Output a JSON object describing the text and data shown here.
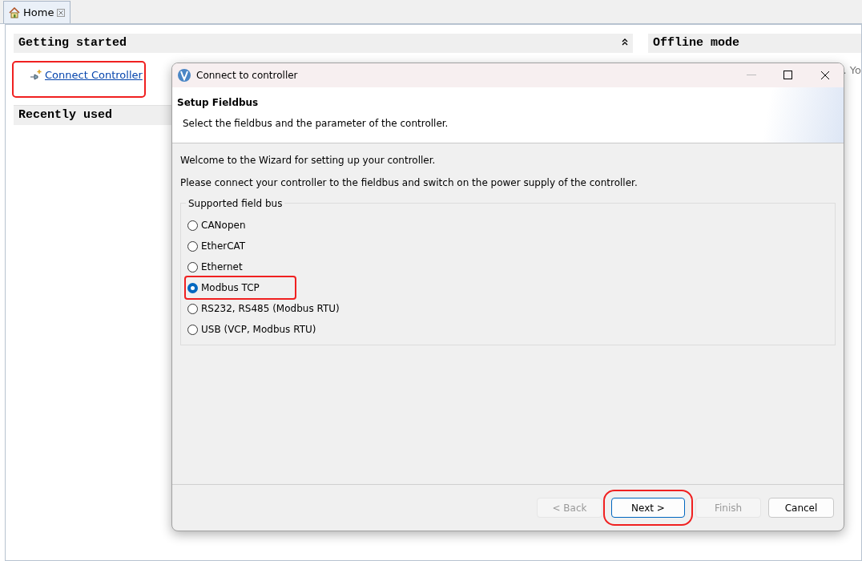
{
  "tab": {
    "label": "Home",
    "selected": true
  },
  "left_sections": [
    {
      "title": "Getting started",
      "collapsible": true,
      "links": [
        {
          "label": "Connect Controller",
          "highlighted": true
        }
      ]
    },
    {
      "title": "Recently used"
    }
  ],
  "right_section": {
    "title": "Offline mode",
    "text": ". Yo"
  },
  "dialog": {
    "title": "Connect to controller",
    "heading": "Setup Fieldbus",
    "description": "Select the fieldbus and the parameter of the controller.",
    "intro": [
      "Welcome to the Wizard for setting up your controller.",
      "Please connect your controller to the fieldbus and switch on the power supply of the controller."
    ],
    "group": {
      "label": "Supported field bus",
      "options": [
        {
          "label": "CANopen",
          "selected": false,
          "highlighted": false
        },
        {
          "label": "EtherCAT",
          "selected": false,
          "highlighted": false
        },
        {
          "label": "Ethernet",
          "selected": false,
          "highlighted": false
        },
        {
          "label": "Modbus TCP",
          "selected": true,
          "highlighted": true
        },
        {
          "label": "RS232, RS485 (Modbus RTU)",
          "selected": false,
          "highlighted": false
        },
        {
          "label": "USB (VCP, Modbus RTU)",
          "selected": false,
          "highlighted": false
        }
      ]
    },
    "buttons": [
      {
        "label": "< Back",
        "disabled": true,
        "default": false,
        "highlighted": false
      },
      {
        "label": "Next >",
        "disabled": false,
        "default": true,
        "highlighted": true
      },
      {
        "label": "Finish",
        "disabled": true,
        "default": false,
        "highlighted": false
      },
      {
        "label": "Cancel",
        "disabled": false,
        "default": false,
        "highlighted": false
      }
    ]
  }
}
